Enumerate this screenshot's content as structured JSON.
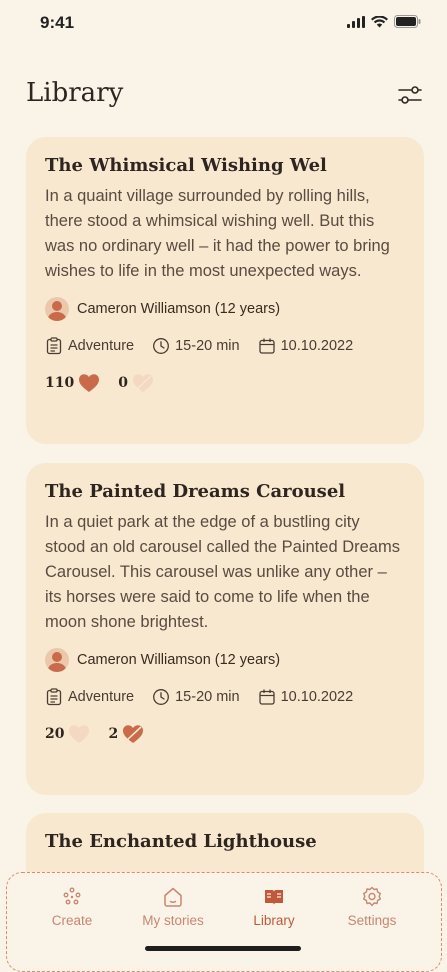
{
  "status": {
    "time": "9:41"
  },
  "header": {
    "title": "Library"
  },
  "stories": [
    {
      "title": "The Whimsical Wishing Wel",
      "description": "In a quaint village surrounded by rolling hills, there stood a whimsical wishing well. But this was no ordinary well – it had the power to bring wishes to life in the most unexpected ways.",
      "author": "Cameron Williamson (12 years)",
      "genre": "Adventure",
      "duration": "15-20 min",
      "date": "10.10.2022",
      "likes": "110",
      "dislikes": "0"
    },
    {
      "title": "The Painted Dreams Carousel",
      "description": "In a quiet park at the edge of a bustling city stood an old carousel called the Painted Dreams Carousel. This carousel was unlike any other – its horses were said to come to life when the moon shone brightest.",
      "author": "Cameron Williamson (12 years)",
      "genre": "Adventure",
      "duration": "15-20 min",
      "date": "10.10.2022",
      "likes": "20",
      "dislikes": "2"
    },
    {
      "title": "The Enchanted Lighthouse"
    }
  ],
  "tabs": [
    {
      "label": "Create",
      "icon": "sparkle-dots-icon"
    },
    {
      "label": "My stories",
      "icon": "home-icon"
    },
    {
      "label": "Library",
      "icon": "book-icon",
      "active": true
    },
    {
      "label": "Settings",
      "icon": "gear-icon"
    }
  ],
  "colors": {
    "accent": "#C0593B",
    "card": "#F7E8CF",
    "background": "#FAF3E8"
  }
}
